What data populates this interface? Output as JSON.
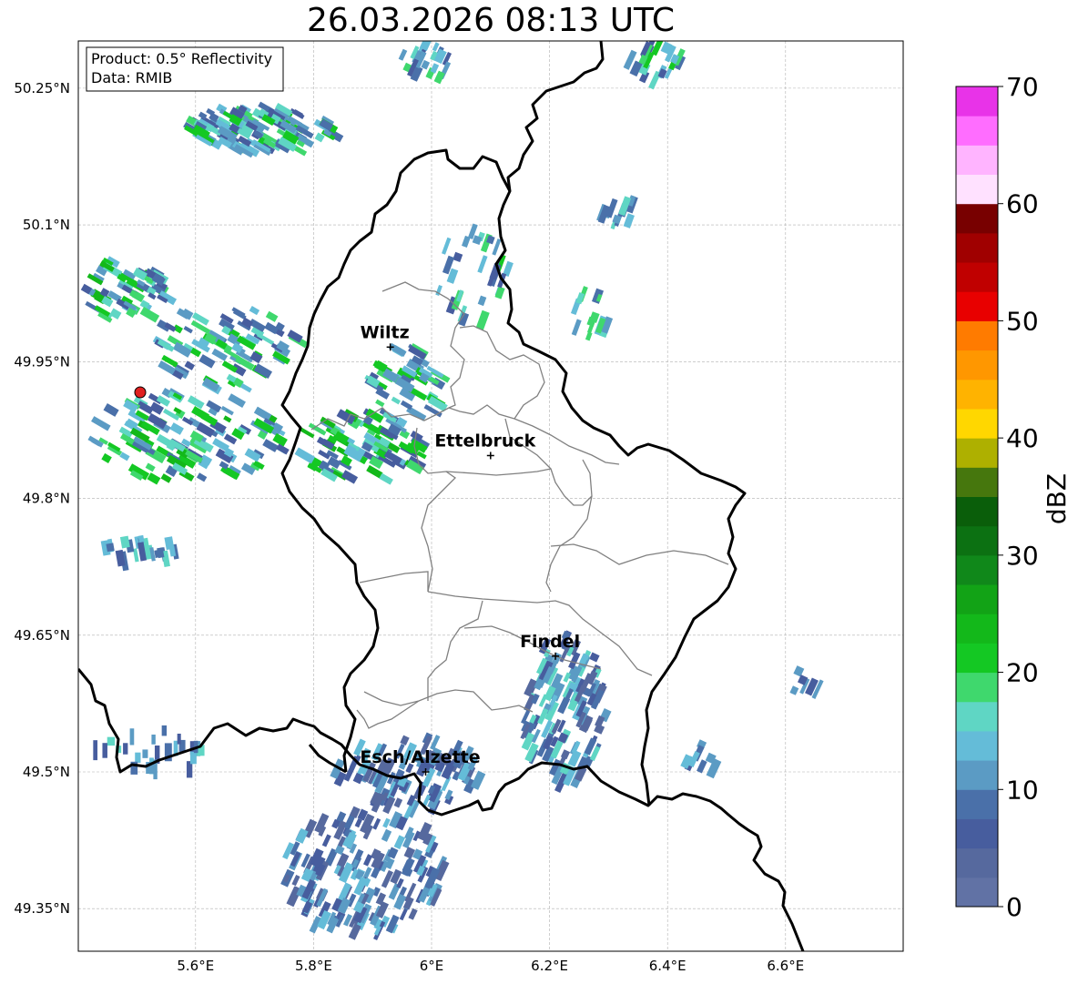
{
  "title": "26.03.2026 08:13 UTC",
  "info_box": {
    "product": "Product: 0.5° Reflectivity",
    "data": "Data: RMIB"
  },
  "lat_ticks": [
    {
      "value": 50.25,
      "label": "50.25°N"
    },
    {
      "value": 50.1,
      "label": "50.1°N"
    },
    {
      "value": 49.95,
      "label": "49.95°N"
    },
    {
      "value": 49.8,
      "label": "49.8°N"
    },
    {
      "value": 49.65,
      "label": "49.65°N"
    },
    {
      "value": 49.5,
      "label": "49.5°N"
    },
    {
      "value": 49.35,
      "label": "49.35°N"
    }
  ],
  "lon_ticks": [
    {
      "value": 5.6,
      "label": "5.6°E"
    },
    {
      "value": 5.8,
      "label": "5.8°E"
    },
    {
      "value": 6.0,
      "label": "6°E"
    },
    {
      "value": 6.2,
      "label": "6.2°E"
    },
    {
      "value": 6.4,
      "label": "6.4°E"
    },
    {
      "value": 6.6,
      "label": "6.6°E"
    }
  ],
  "cities": [
    {
      "name": "Wiltz",
      "lon": 5.93,
      "lat": 49.966
    },
    {
      "name": "Ettelbruck",
      "lon": 6.1,
      "lat": 49.847
    },
    {
      "name": "Findel",
      "lon": 6.21,
      "lat": 49.627
    },
    {
      "name": "Esch/Alzette",
      "lon": 5.99,
      "lat": 49.5
    }
  ],
  "radar_site": {
    "lon": 5.505,
    "lat": 49.914
  },
  "colorbar": {
    "label": "dBZ",
    "min": 0,
    "max": 70,
    "ticks": [
      "0",
      "10",
      "20",
      "30",
      "40",
      "50",
      "60",
      "70"
    ],
    "colors": [
      "#6172a5",
      "#56699e",
      "#475d9e",
      "#4a70a9",
      "#5b9bc4",
      "#64bcd8",
      "#5fd6c4",
      "#3fd86d",
      "#14c823",
      "#13b81a",
      "#12a316",
      "#10881a",
      "#0c7112",
      "#0a5e0a",
      "#46770d",
      "#aeb000",
      "#ffd700",
      "#ffb300",
      "#ff9700",
      "#ff7b00",
      "#e80000",
      "#c00000",
      "#a00000",
      "#780000",
      "#ffe1ff",
      "#ffb4ff",
      "#ff6dff",
      "#e833e8"
    ]
  }
}
